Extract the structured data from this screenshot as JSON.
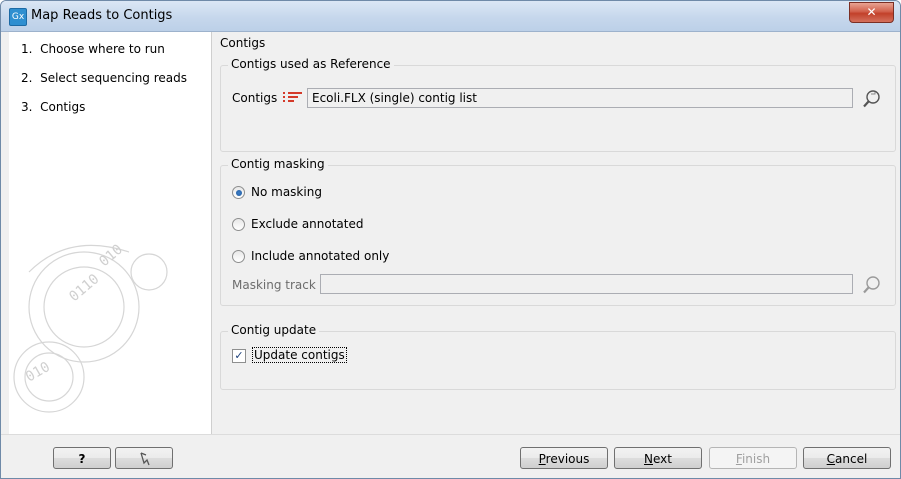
{
  "window": {
    "title": "Map Reads to Contigs",
    "app_icon": "Gx",
    "close_glyph": "✕"
  },
  "steps": [
    {
      "num": "1.",
      "label": "Choose where to run"
    },
    {
      "num": "2.",
      "label": "Select sequencing reads"
    },
    {
      "num": "3.",
      "label": "Contigs"
    }
  ],
  "content": {
    "section_title": "Contigs",
    "reference_group": {
      "title": "Contigs used as Reference",
      "label": "Contigs",
      "value": "Ecoli.FLX (single) contig list",
      "icon": "contig-list-icon"
    },
    "masking_group": {
      "title": "Contig masking",
      "options": [
        "No masking",
        "Exclude annotated",
        "Include annotated only"
      ],
      "selected_index": 0,
      "track_label": "Masking track",
      "track_value": ""
    },
    "update_group": {
      "title": "Contig update",
      "checkbox_label": "Update contigs",
      "checked": true
    }
  },
  "footer": {
    "help": "?",
    "reset_icon": "reset-icon",
    "previous": {
      "first": "P",
      "rest": "revious"
    },
    "next": {
      "first": "N",
      "rest": "ext"
    },
    "finish": {
      "first": "F",
      "rest": "inish"
    },
    "cancel": {
      "first": "C",
      "rest": "ancel"
    }
  },
  "colors": {
    "accent": "#2f8fd0",
    "close": "#c2402a",
    "contig_icon": "#d43a2a"
  }
}
